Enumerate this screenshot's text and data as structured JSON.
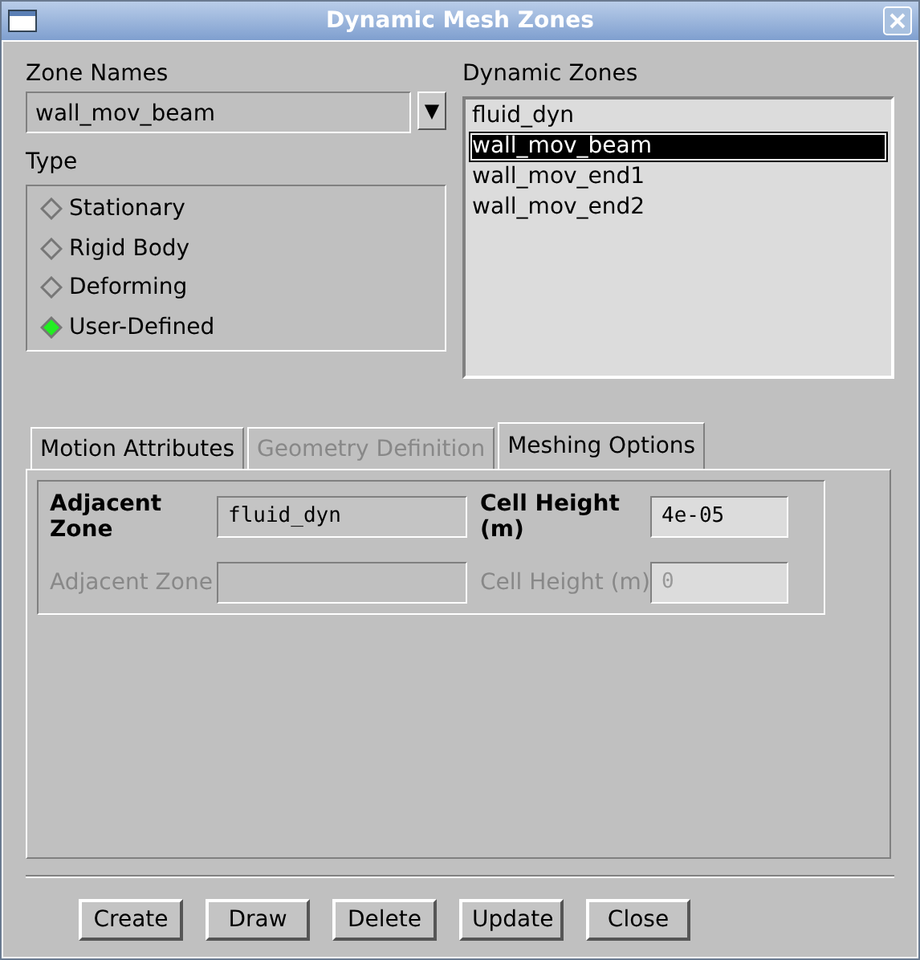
{
  "window": {
    "title": "Dynamic Mesh Zones"
  },
  "zone_names": {
    "label": "Zone Names",
    "value": "wall_mov_beam",
    "arrow": "▼"
  },
  "type": {
    "label": "Type",
    "options": [
      {
        "label": "Stationary",
        "selected": false
      },
      {
        "label": "Rigid Body",
        "selected": false
      },
      {
        "label": "Deforming",
        "selected": false
      },
      {
        "label": "User-Defined",
        "selected": true
      }
    ]
  },
  "dynamic_zones": {
    "label": "Dynamic Zones",
    "items": [
      {
        "label": "fluid_dyn",
        "selected": false
      },
      {
        "label": "wall_mov_beam",
        "selected": true
      },
      {
        "label": "wall_mov_end1",
        "selected": false
      },
      {
        "label": "wall_mov_end2",
        "selected": false
      }
    ]
  },
  "tabs": [
    {
      "label": "Motion Attributes",
      "selected": false,
      "disabled": false
    },
    {
      "label": "Geometry Definition",
      "selected": false,
      "disabled": true
    },
    {
      "label": "Meshing Options",
      "selected": true,
      "disabled": false
    }
  ],
  "meshing_rows": [
    {
      "zone_label": "Adjacent Zone",
      "zone_value": "fluid_dyn",
      "height_label": "Cell Height (m)",
      "height_value": "4e-05",
      "disabled": false
    },
    {
      "zone_label": "Adjacent Zone",
      "zone_value": "",
      "height_label": "Cell Height (m)",
      "height_value": "0",
      "disabled": true
    }
  ],
  "buttons": [
    "Create",
    "Draw",
    "Delete",
    "Update",
    "Close"
  ]
}
